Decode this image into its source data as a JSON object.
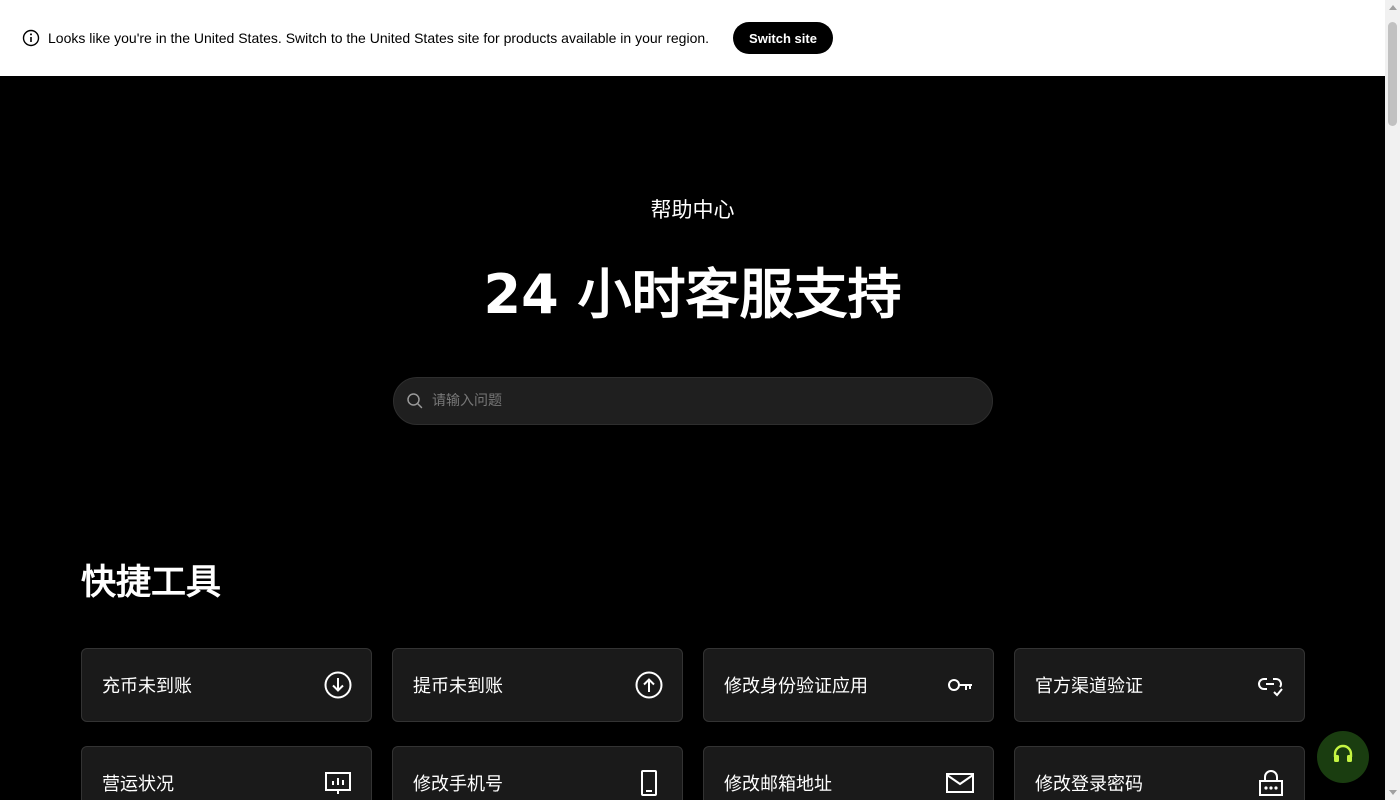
{
  "banner": {
    "message": "Looks like you're in the United States. Switch to the United States site for products available in your region.",
    "switch_label": "Switch site"
  },
  "hero": {
    "eyebrow": "帮助中心",
    "title": "24 小时客服支持"
  },
  "search": {
    "placeholder": "请输入问题",
    "value": ""
  },
  "quick_tools": {
    "title": "快捷工具",
    "items": [
      {
        "label": "充币未到账",
        "icon": "download-circle-icon"
      },
      {
        "label": "提币未到账",
        "icon": "upload-circle-icon"
      },
      {
        "label": "修改身份验证应用",
        "icon": "key-icon"
      },
      {
        "label": "官方渠道验证",
        "icon": "link-check-icon"
      },
      {
        "label": "营运状况",
        "icon": "status-monitor-icon"
      },
      {
        "label": "修改手机号",
        "icon": "mobile-phone-icon"
      },
      {
        "label": "修改邮箱地址",
        "icon": "mail-icon"
      },
      {
        "label": "修改登录密码",
        "icon": "lock-password-icon"
      }
    ]
  },
  "colors": {
    "background": "#000000",
    "banner_bg": "#ffffff",
    "card_bg": "#1a1a1a",
    "support_bg": "#1a3d10",
    "support_accent": "#c4f542"
  }
}
